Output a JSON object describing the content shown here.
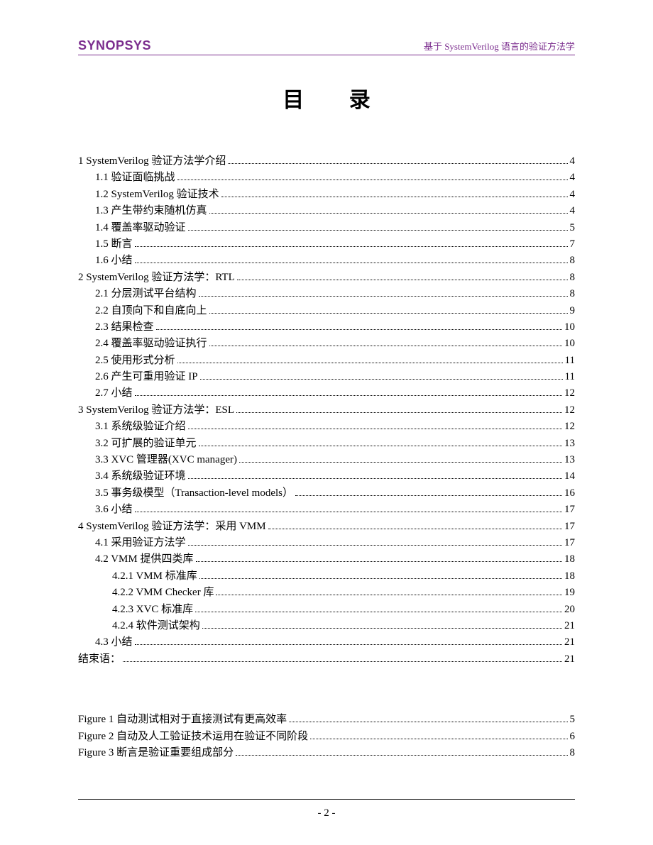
{
  "header": {
    "brand": "SYNOPSYS",
    "right": "基于 SystemVerilog 语言的验证方法学"
  },
  "toc_title": "目 录",
  "toc": [
    {
      "indent": 0,
      "label": "1  SystemVerilog 验证方法学介绍",
      "page": "4"
    },
    {
      "indent": 1,
      "label": "1.1  验证面临挑战 ",
      "page": "4"
    },
    {
      "indent": 1,
      "label": "1.2  SystemVerilog 验证技术",
      "page": "4"
    },
    {
      "indent": 1,
      "label": "1.3  产生带约束随机仿真 ",
      "page": "4"
    },
    {
      "indent": 1,
      "label": "1.4  覆盖率驱动验证 ",
      "page": "5"
    },
    {
      "indent": 1,
      "label": "1.5  断言 ",
      "page": "7"
    },
    {
      "indent": 1,
      "label": "1.6  小结 ",
      "page": "8"
    },
    {
      "indent": 0,
      "label": "2  SystemVerilog 验证方法学：RTL ",
      "page": "8"
    },
    {
      "indent": 1,
      "label": "2.1  分层测试平台结构 ",
      "page": "8"
    },
    {
      "indent": 1,
      "label": "2.2  自顶向下和自底向上 ",
      "page": "9"
    },
    {
      "indent": 1,
      "label": "2.3  结果检查 ",
      "page": "10"
    },
    {
      "indent": 1,
      "label": "2.4  覆盖率驱动验证执行 ",
      "page": "10"
    },
    {
      "indent": 1,
      "label": "2.5  使用形式分析 ",
      "page": "11"
    },
    {
      "indent": 1,
      "label": "2.6  产生可重用验证 IP",
      "page": "11"
    },
    {
      "indent": 1,
      "label": "2.7  小结 ",
      "page": "12"
    },
    {
      "indent": 0,
      "label": "3  SystemVerilog 验证方法学：ESL ",
      "page": "12"
    },
    {
      "indent": 1,
      "label": "3.1  系统级验证介绍 ",
      "page": "12"
    },
    {
      "indent": 1,
      "label": "3.2  可扩展的验证单元 ",
      "page": "13"
    },
    {
      "indent": 1,
      "label": "3.3  XVC 管理器(XVC manager) ",
      "page": "13"
    },
    {
      "indent": 1,
      "label": "3.4  系统级验证环境 ",
      "page": "14"
    },
    {
      "indent": 1,
      "label": "3.5  事务级模型（Transaction-level models） ",
      "page": "16"
    },
    {
      "indent": 1,
      "label": "3.6  小结 ",
      "page": "17"
    },
    {
      "indent": 0,
      "label": "4  SystemVerilog 验证方法学：采用 VMM",
      "page": "17"
    },
    {
      "indent": 1,
      "label": "4.1  采用验证方法学 ",
      "page": "17"
    },
    {
      "indent": 1,
      "label": "4.2  VMM 提供四类库",
      "page": "18"
    },
    {
      "indent": 2,
      "label": "4.2.1  VMM 标准库",
      "page": "18"
    },
    {
      "indent": 2,
      "label": "4.2.2  VMM Checker 库 ",
      "page": "19"
    },
    {
      "indent": 2,
      "label": "4.2.3  XVC 标准库 ",
      "page": "20"
    },
    {
      "indent": 2,
      "label": "4.2.4  软件测试架构 ",
      "page": "21"
    },
    {
      "indent": 1,
      "label": "4.3  小结 ",
      "page": "21"
    },
    {
      "indent": 0,
      "label": "结束语： ",
      "page": "21"
    }
  ],
  "figures": [
    {
      "label": "Figure 1  自动测试相对于直接测试有更高效率 ",
      "page": "5"
    },
    {
      "label": "Figure 2  自动及人工验证技术运用在验证不同阶段",
      "page": "6"
    },
    {
      "label": "Figure 3   断言是验证重要组成部分 ",
      "page": "8"
    }
  ],
  "page_number": "- 2 -"
}
